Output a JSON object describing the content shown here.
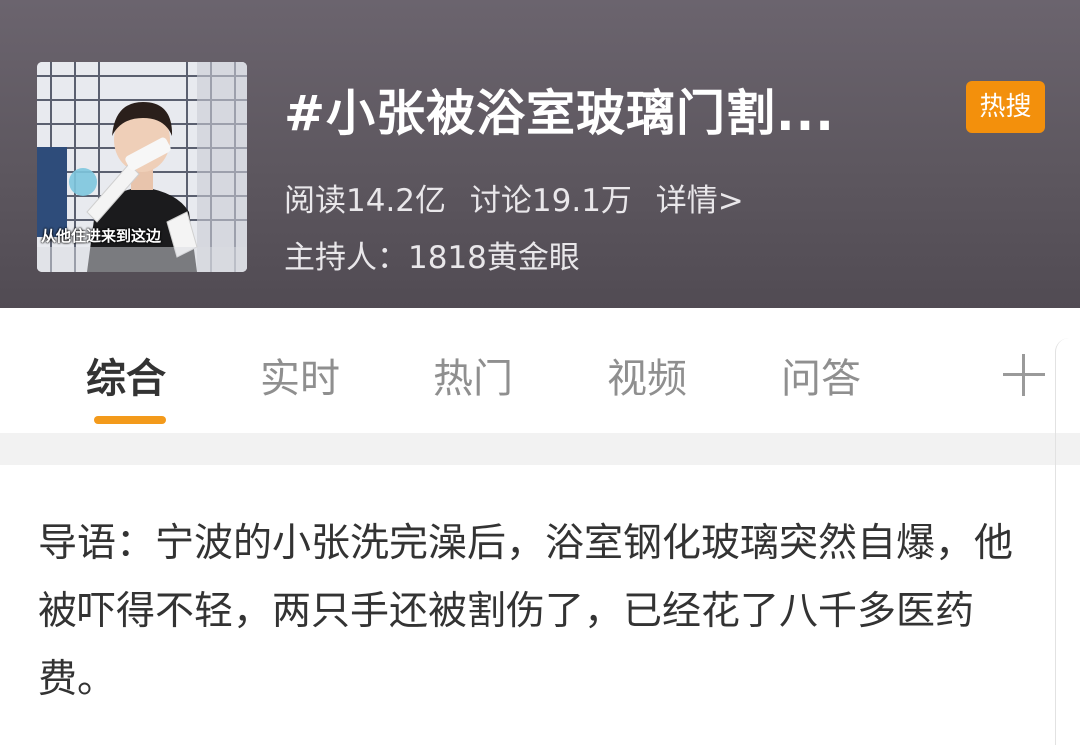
{
  "header": {
    "thumbnail_caption": "从他住进来到这边",
    "title": "#小张被浴室玻璃门割...",
    "hot_badge": "热搜",
    "stats": {
      "reads": "阅读14.2亿",
      "discussions": "讨论19.1万",
      "details": "详情>"
    },
    "host": "主持人：1818黄金眼"
  },
  "tabs": [
    {
      "label": "综合",
      "active": true
    },
    {
      "label": "实时",
      "active": false
    },
    {
      "label": "热门",
      "active": false
    },
    {
      "label": "视频",
      "active": false
    },
    {
      "label": "问答",
      "active": false
    }
  ],
  "tab_add_icon": "plus-icon",
  "lead": {
    "text": "导语：宁波的小张洗完澡后，浴室钢化玻璃突然自爆，他被吓得不轻，两只手还被割伤了，已经花了八千多医药费。"
  },
  "colors": {
    "header_bg": "#5d575f",
    "hot_badge": "#f3900c",
    "tab_underline": "#f39a1b"
  }
}
